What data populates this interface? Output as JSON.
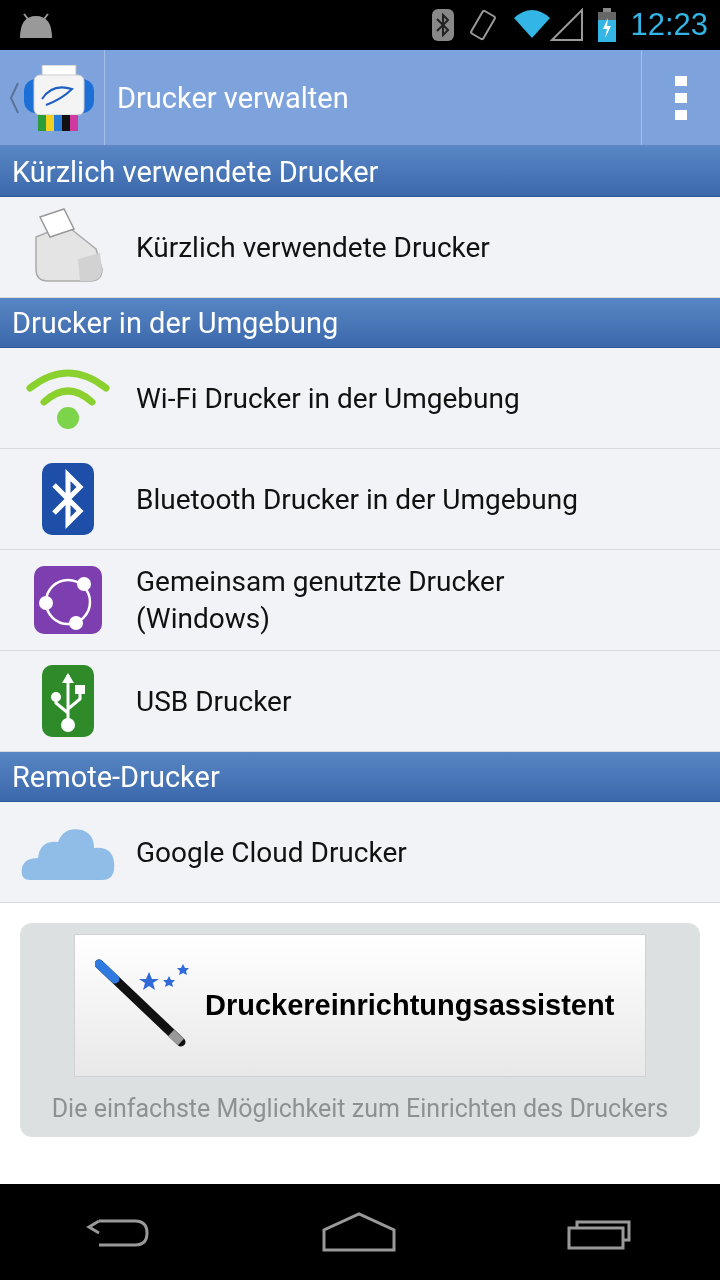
{
  "status_bar": {
    "time": "12:23"
  },
  "action_bar": {
    "title": "Drucker verwalten"
  },
  "sections": [
    {
      "title": "Kürzlich verwendete Drucker",
      "items": [
        {
          "kind": "printer",
          "label": "Kürzlich verwendete Drucker"
        }
      ]
    },
    {
      "title": "Drucker in der Umgebung",
      "items": [
        {
          "kind": "wifi",
          "label": "Wi-Fi Drucker in der Umgebung"
        },
        {
          "kind": "bluetooth",
          "label": "Bluetooth Drucker in der Umgebung"
        },
        {
          "kind": "shared",
          "label": "Gemeinsam genutzte Drucker (Windows)"
        },
        {
          "kind": "usb",
          "label": "USB Drucker"
        }
      ]
    },
    {
      "title": "Remote-Drucker",
      "items": [
        {
          "kind": "cloud",
          "label": "Google Cloud Drucker"
        }
      ]
    }
  ],
  "wizard": {
    "button": "Druckereinrichtungsassistent",
    "description": "Die einfachste Möglichkeit zum Einrichten des Druckers"
  }
}
